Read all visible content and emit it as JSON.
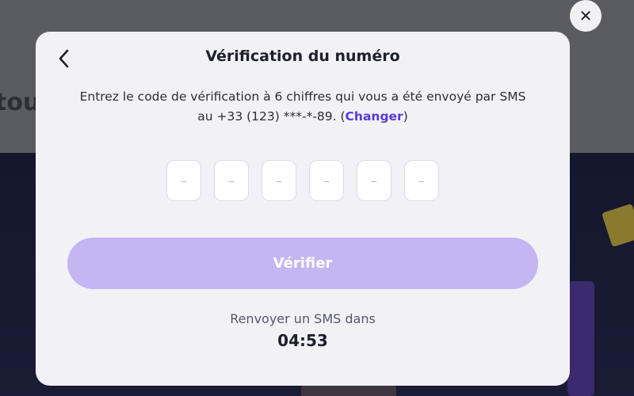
{
  "background": {
    "partial_heading": "tou"
  },
  "modal": {
    "title": "Vérification du numéro",
    "description_text": "Entrez le code de vérification à 6 chiffres qui vous a été envoyé par SMS au +33 (123) ***-*-89. (",
    "change_link": "Changer",
    "description_close": ")",
    "code_placeholders": [
      "–",
      "–",
      "–",
      "–",
      "–",
      "–"
    ],
    "verify_label": "Vérifier",
    "resend_label": "Renvoyer un SMS dans",
    "timer": "04:53"
  },
  "icons": {
    "close": "close-icon",
    "back": "chevron-left-icon"
  },
  "colors": {
    "accent": "#5a3ad6",
    "button_disabled": "#c4b5f3",
    "modal_bg": "#f2f2f6"
  },
  "close_glyph": "✕"
}
